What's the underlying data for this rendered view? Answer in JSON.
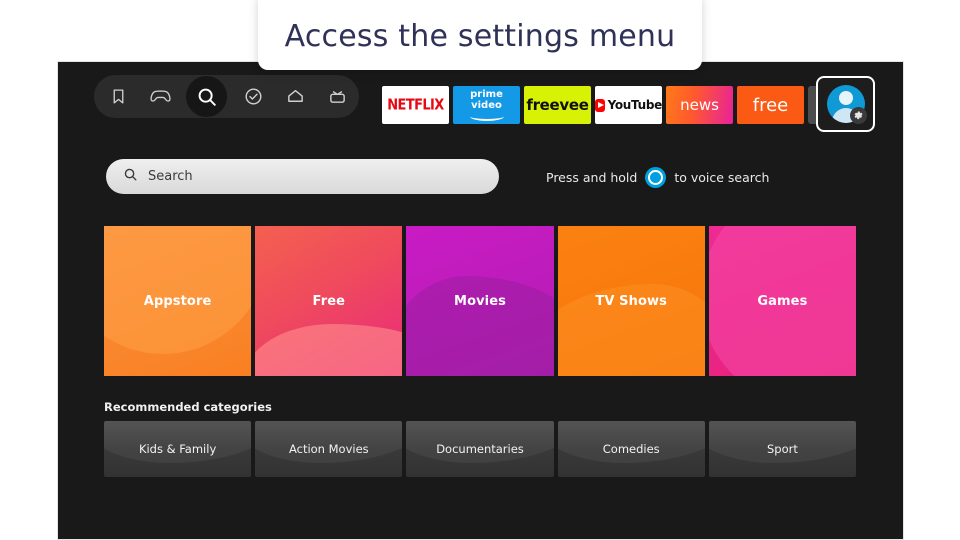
{
  "tooltip": {
    "text": "Access the settings menu"
  },
  "topbar": {
    "nav_icons": [
      {
        "name": "bookmark-icon",
        "label": "Bookmarks",
        "selected": false
      },
      {
        "name": "gamepad-icon",
        "label": "Games",
        "selected": false
      },
      {
        "name": "search-icon",
        "label": "Search",
        "selected": true
      },
      {
        "name": "check-circle-icon",
        "label": "My Stuff",
        "selected": false
      },
      {
        "name": "home-icon",
        "label": "Home",
        "selected": false
      },
      {
        "name": "tv-icon",
        "label": "Live TV",
        "selected": false
      }
    ],
    "apps": [
      {
        "name": "netflix-app",
        "label": "NETFLIX"
      },
      {
        "name": "prime-video-app",
        "label_line1": "prime",
        "label_line2": "video"
      },
      {
        "name": "freevee-app",
        "label": "freevee"
      },
      {
        "name": "youtube-app",
        "label": "YouTube"
      },
      {
        "name": "news-app",
        "label": "news"
      },
      {
        "name": "free-app",
        "label": "free"
      }
    ],
    "apps_grid_label": "",
    "profile": {
      "name": "profile-settings-button",
      "badge": "gear-icon",
      "focused": true
    }
  },
  "search": {
    "placeholder": "Search",
    "voice_hint_before": "Press and hold",
    "voice_hint_after": "to voice search",
    "voice_icon": "alexa-icon"
  },
  "tiles": [
    {
      "label": "Appstore",
      "color": "#f9872f"
    },
    {
      "label": "Free",
      "color": "#ef4a5d"
    },
    {
      "label": "Movies",
      "color": "#bd1cbb"
    },
    {
      "label": "TV Shows",
      "color": "#f97b0e"
    },
    {
      "label": "Games",
      "color": "#ea2586"
    }
  ],
  "recommended": {
    "heading": "Recommended categories",
    "items": [
      {
        "label": "Kids & Family"
      },
      {
        "label": "Action Movies"
      },
      {
        "label": "Documentaries"
      },
      {
        "label": "Comedies"
      },
      {
        "label": "Sport"
      }
    ]
  }
}
